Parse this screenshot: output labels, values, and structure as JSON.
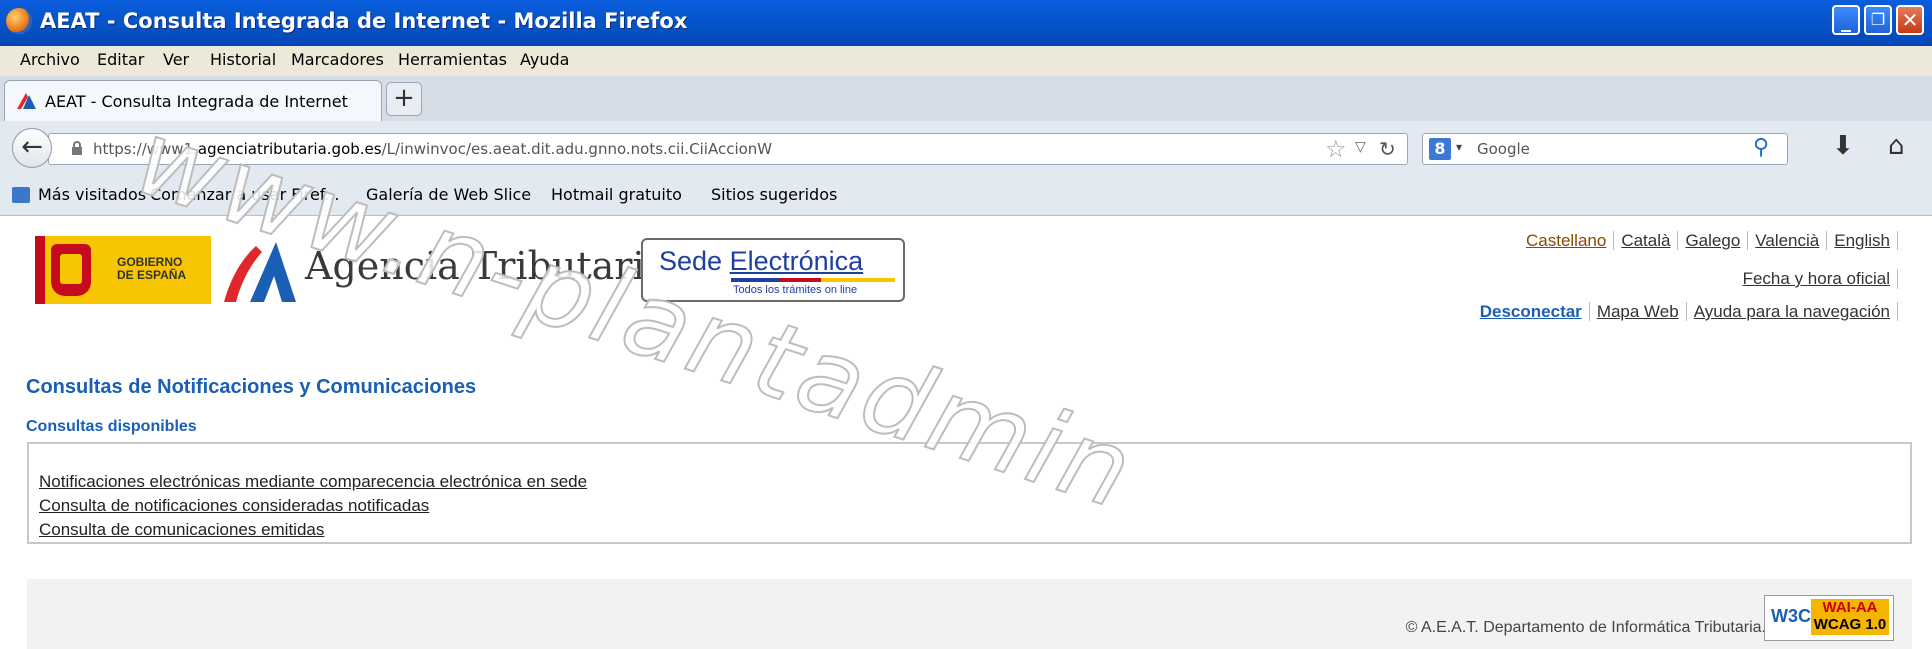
{
  "window": {
    "title": "AEAT - Consulta Integrada de Internet - Mozilla Firefox",
    "controls": {
      "minimize": "_",
      "restore": "❐",
      "close": "✕"
    }
  },
  "menu": [
    "Archivo",
    "Editar",
    "Ver",
    "Historial",
    "Marcadores",
    "Herramientas",
    "Ayuda"
  ],
  "tab": {
    "label": "AEAT - Consulta Integrada de Internet",
    "new_tab": "+"
  },
  "nav": {
    "url_prefix": "https://www1.",
    "url_domain": "agenciatributaria.gob.es",
    "url_path": "/L/inwinvoc/es.aeat.dit.adu.gnno.nots.cii.CiiAccionW",
    "search_engine": "Google"
  },
  "bookmarks": [
    "Más visitados",
    "Comenzar a usar Firef...",
    "Galería de Web Slice",
    "Hotmail gratuito",
    "Sitios sugeridos"
  ],
  "header": {
    "gobierno": "GOBIERNO",
    "espana": "DE ESPAÑA",
    "agencia": "Agencia Tributaria",
    "sede_a": "Sede ",
    "sede_b": "Electrónica",
    "sede_sub": "Todos los trámites on line",
    "languages": [
      "Castellano",
      "Català",
      "Galego",
      "Valencià",
      "English"
    ],
    "fecha": "Fecha y hora oficial",
    "desconectar": "Desconectar",
    "mapa": "Mapa Web",
    "ayuda": "Ayuda para la navegación"
  },
  "main": {
    "title": "Consultas de Notificaciones y Comunicaciones",
    "subtitle": "Consultas disponibles",
    "links": [
      "Notificaciones electrónicas mediante comparecencia electrónica en sede",
      "Consulta de notificaciones consideradas notificadas",
      "Consulta de comunicaciones emitidas"
    ]
  },
  "footer": {
    "copyright": "© A.E.A.T. Departamento de Informática Tributaria.",
    "w3c": "W3C",
    "wai": "WAI-AA",
    "wcag": "WCAG 1.0"
  },
  "watermark": "www.n-plantadmin",
  "colors": {
    "link_blue": "#1a5fb4",
    "titlebar": "#0652c5",
    "flag_yellow": "#f7c600",
    "flag_red": "#c60b1e"
  }
}
